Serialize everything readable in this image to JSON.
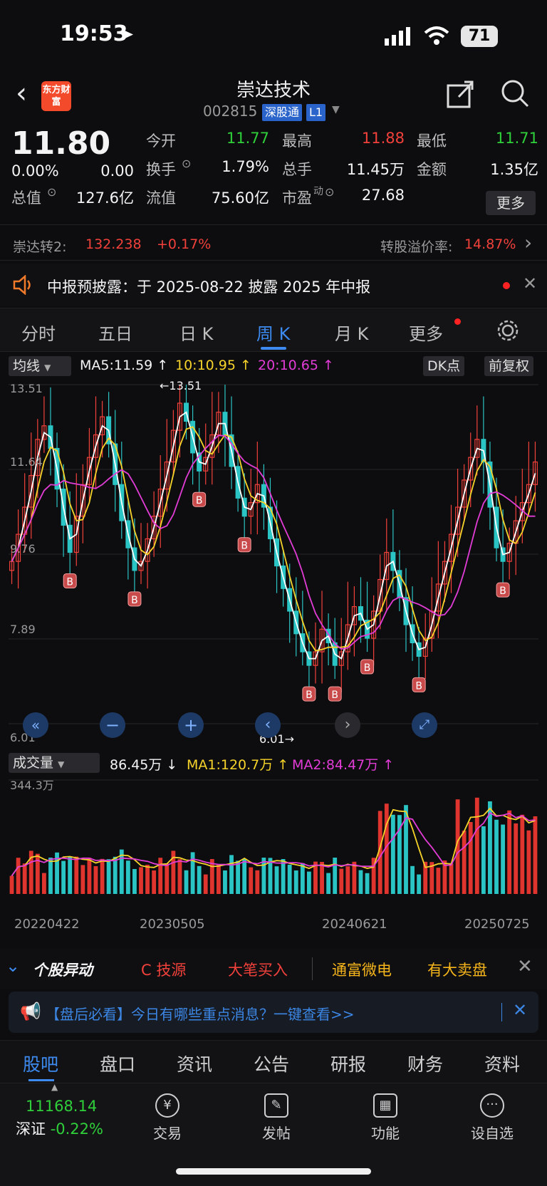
{
  "status_bar": {
    "time": "19:53",
    "battery": "71"
  },
  "header": {
    "logo_text": "东方财富",
    "stock_name": "崇达技术",
    "stock_code": "002815",
    "tag_connect": "深股通",
    "tag_level": "L1"
  },
  "quote": {
    "price": "11.80",
    "change_pct": "0.00%",
    "change": "0.00",
    "open_label": "今开",
    "open": "11.77",
    "high_label": "最高",
    "high": "11.88",
    "low_label": "最低",
    "low": "11.71",
    "turnover_label": "换手",
    "turnover": "1.79%",
    "volume_label": "总手",
    "volume": "11.45万",
    "amount_label": "金额",
    "amount": "1.35亿",
    "total_value_label": "总值",
    "total_value": "127.6亿",
    "float_value_label": "流值",
    "float_value": "75.60亿",
    "pe_label": "市盈",
    "pe_superscript": "动",
    "pe": "27.68",
    "more_button": "更多"
  },
  "bond": {
    "name": "崇达转2:",
    "price": "132.238",
    "change": "+0.17%",
    "premium_label": "转股溢价率:",
    "premium": "14.87%"
  },
  "notice": {
    "text": "中报预披露：于 2025-08-22 披露 2025 年中报"
  },
  "chart_tabs": [
    {
      "label": "分时"
    },
    {
      "label": "五日"
    },
    {
      "label": "日 K"
    },
    {
      "label": "周 K"
    },
    {
      "label": "月 K"
    },
    {
      "label": "更多"
    }
  ],
  "kline_toolbar": {
    "indicator_select": "均线",
    "ma5": "MA5:11.59 ↑",
    "ma10": "10:10.95 ↑",
    "ma20": "20:10.65 ↑",
    "dk_button": "DK点",
    "adjust_button": "前复权"
  },
  "vol_toolbar": {
    "indicator_select": "成交量",
    "vol": "86.45万 ↓",
    "ma1": "MA1:120.7万 ↑",
    "ma2": "MA2:84.47万 ↑"
  },
  "chart_data": {
    "type": "candlestick",
    "price_axis_labels": [
      "13.51",
      "11.64",
      "9.76",
      "7.89",
      "6.01"
    ],
    "ylim": [
      6.01,
      13.51
    ],
    "high_marker": "←13.51",
    "low_marker": "6.01→",
    "volume_axis_max": "344.3万",
    "date_labels": [
      "20220422",
      "20230505",
      "20240621",
      "20250725"
    ],
    "series": [
      {
        "name": "MA5",
        "color": "#ffffff"
      },
      {
        "name": "MA10",
        "color": "#f6d32a"
      },
      {
        "name": "MA20",
        "color": "#e23cd6"
      }
    ],
    "close": [
      9.6,
      10.2,
      10.8,
      11.5,
      12.3,
      12.6,
      12.1,
      11.2,
      10.4,
      9.8,
      10.6,
      11.3,
      11.9,
      12.4,
      12.8,
      12.2,
      11.3,
      10.5,
      9.9,
      9.4,
      9.6,
      10.1,
      10.6,
      11.2,
      11.8,
      12.5,
      13.1,
      12.7,
      12.0,
      11.6,
      11.9,
      12.4,
      12.9,
      12.4,
      11.7,
      11.0,
      10.6,
      10.9,
      11.3,
      10.8,
      10.1,
      9.5,
      9.0,
      8.5,
      8.0,
      7.6,
      7.3,
      7.6,
      8.1,
      7.8,
      7.3,
      7.6,
      8.2,
      8.6,
      8.3,
      7.9,
      8.5,
      9.2,
      9.8,
      9.4,
      8.8,
      8.2,
      7.8,
      7.5,
      7.9,
      8.5,
      9.1,
      9.6,
      10.2,
      10.8,
      11.4,
      11.9,
      12.3,
      11.8,
      10.8,
      9.9,
      9.6,
      10.0,
      10.5,
      10.9,
      11.3,
      11.8
    ]
  },
  "alerts": {
    "title": "个股异动",
    "items": [
      {
        "label": "C 技源",
        "color": "#f2413b"
      },
      {
        "label": "大笔买入",
        "color": "#f2413b"
      },
      {
        "label": "通富微电",
        "color": "#f6b51a"
      },
      {
        "label": "有大卖盘",
        "color": "#f6b51a"
      }
    ]
  },
  "banner": {
    "text": "【盘后必看】今日有哪些重点消息？一键查看>>"
  },
  "bottom_tabs": [
    "股吧",
    "盘口",
    "资讯",
    "公告",
    "研报",
    "财务",
    "资料"
  ],
  "index": {
    "value": "11168.14",
    "name": "深证",
    "change": "-0.22%"
  },
  "toolbar": [
    "交易",
    "发帖",
    "功能",
    "设自选"
  ]
}
